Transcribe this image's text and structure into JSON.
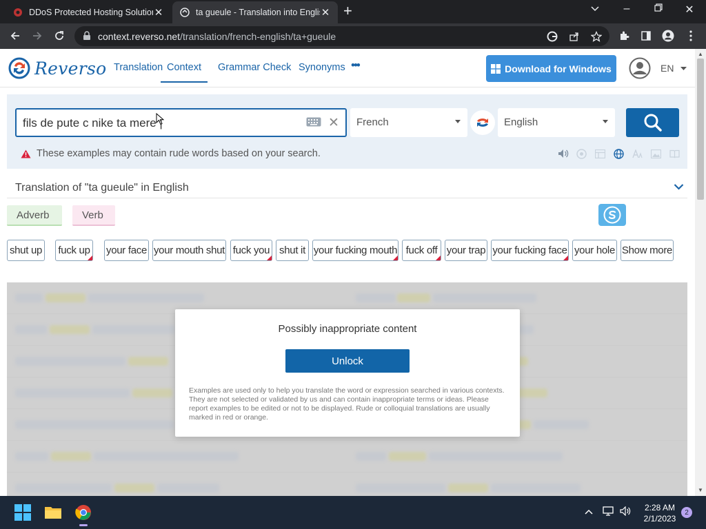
{
  "browser": {
    "tabs": [
      {
        "title": "DDoS Protected Hosting Solution",
        "active": false
      },
      {
        "title": "ta gueule - Translation into Englis",
        "active": true
      }
    ],
    "url_host": "context.reverso.net",
    "url_path": "/translation/french-english/ta+gueule"
  },
  "site": {
    "logo_text": "Reverso",
    "nav": [
      "Translation",
      "Context",
      "Grammar Check",
      "Synonyms"
    ],
    "more": "•••",
    "download_label": "Download for Windows",
    "language": "EN"
  },
  "search": {
    "value": "fils de pute c nike ta mere |",
    "source_lang": "French",
    "target_lang": "English",
    "warning": "These examples may contain rude words based on your search."
  },
  "translation": {
    "heading": "Translation of \"ta gueule\" in English",
    "pos": [
      "Adverb",
      "Verb"
    ],
    "chips": [
      {
        "label": "shut up",
        "red": false
      },
      {
        "label": "fuck up",
        "red": true
      },
      {
        "label": "your face",
        "red": false
      },
      {
        "label": "your mouth shut",
        "red": false
      },
      {
        "label": "fuck you",
        "red": true
      },
      {
        "label": "shut it",
        "red": false
      },
      {
        "label": "your fucking mouth",
        "red": true
      },
      {
        "label": "fuck off",
        "red": true
      },
      {
        "label": "your trap",
        "red": false
      },
      {
        "label": "your fucking face",
        "red": true
      },
      {
        "label": "your hole",
        "red": false
      },
      {
        "label": "Show more",
        "red": false
      }
    ]
  },
  "modal": {
    "title": "Possibly inappropriate content",
    "button": "Unlock",
    "text": "Examples are used only to help you translate the word or expression searched in various contexts. They are not selected or validated by us and can contain inappropriate terms or ideas. Please report examples to be edited or not to be displayed. Rude or colloquial translations are usually marked in red or orange."
  },
  "taskbar": {
    "time": "2:28 AM",
    "date": "2/1/2023",
    "notifications": "2"
  },
  "colors": {
    "brand": "#1a64a8",
    "button": "#1265a8",
    "download": "#3b8fdb",
    "rude_marker": "#d9213c"
  }
}
